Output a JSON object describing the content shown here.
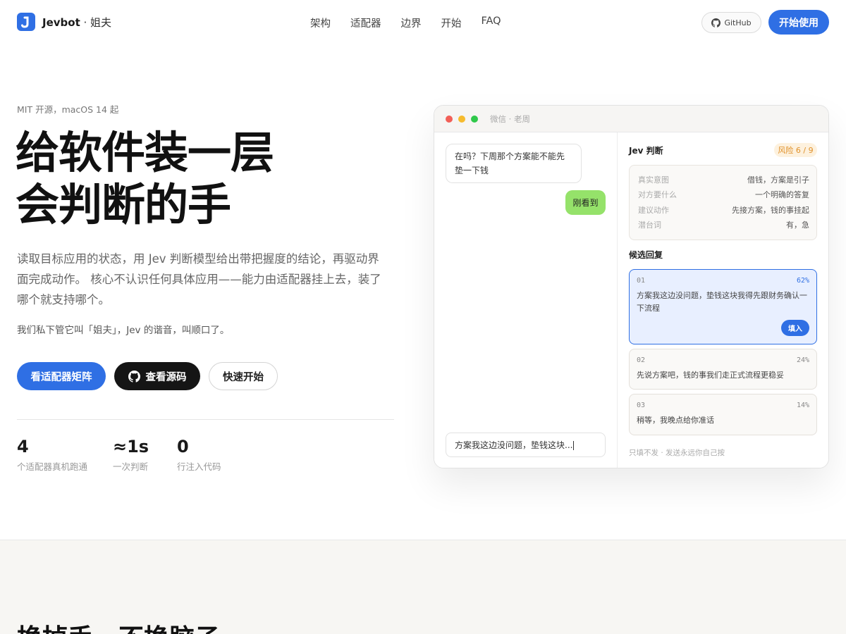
{
  "header": {
    "brand_name": "Jevbot",
    "brand_sub": " · 姐夫",
    "nav": [
      "架构",
      "适配器",
      "边界",
      "开始",
      "FAQ"
    ],
    "github_label": "GitHub",
    "cta_label": "开始使用",
    "accent": "#2f6fe4"
  },
  "hero": {
    "eyebrow": "MIT 开源，macOS 14 起",
    "headline_line1": "给软件装一层",
    "headline_line2": "会判断的手",
    "lead": "读取目标应用的状态，用 Jev 判断模型给出带把握度的结论，再驱动界面完成动作。 核心不认识任何具体应用——能力由适配器挂上去，装了哪个就支持哪个。",
    "aside": "我们私下管它叫「姐夫」，Jev 的谐音，叫顺口了。",
    "btn_adapters": "看适配器矩阵",
    "btn_source": "查看源码",
    "btn_quickstart": "快速开始",
    "stats": [
      {
        "num": "4",
        "label": "个适配器真机跑通"
      },
      {
        "num": "≈1s",
        "label": "一次判断"
      },
      {
        "num": "0",
        "label": "行注入代码"
      }
    ]
  },
  "mock": {
    "window_title": "微信 · 老周",
    "chat": {
      "incoming": "在吗？下周那个方案能不能先垫一下钱",
      "outgoing": "刚看到",
      "input_value": "方案我这边没问题，垫钱这块..."
    },
    "panel": {
      "title": "Jev 判断",
      "risk": "风险 6 / 9",
      "analysis": [
        {
          "k": "真实意图",
          "v": "借钱，方案是引子"
        },
        {
          "k": "对方要什么",
          "v": "一个明确的答复"
        },
        {
          "k": "建议动作",
          "v": "先接方案，钱的事挂起"
        },
        {
          "k": "潜台词",
          "v": "有，急"
        }
      ],
      "candidates_title": "候选回复",
      "candidates": [
        {
          "n": "01",
          "p": "62%",
          "t": "方案我这边没问题，垫钱这块我得先跟财务确认一下流程"
        },
        {
          "n": "02",
          "p": "24%",
          "t": "先说方案吧，钱的事我们走正式流程更稳妥"
        },
        {
          "n": "03",
          "p": "14%",
          "t": "稍等，我晚点给你准话"
        }
      ],
      "fill_label": "填入",
      "footer": "只填不发 · 发送永远你自己按"
    }
  },
  "lower": {
    "title": "换掉手，不换脑子"
  }
}
